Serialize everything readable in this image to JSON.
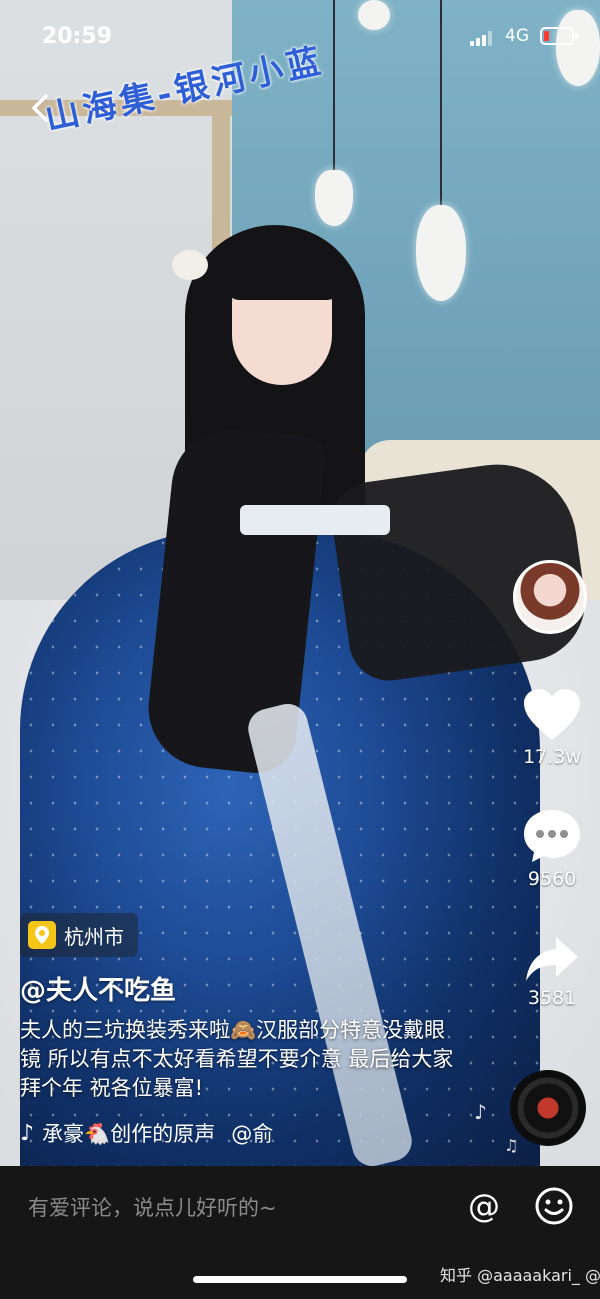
{
  "status_bar": {
    "time": "20:59",
    "network": "4G",
    "battery_level": 0.1,
    "battery_color": "#ff3b30"
  },
  "nav": {
    "back_icon": "chevron-left-icon"
  },
  "overlay_title": "山海集-银河小蓝",
  "right_rail": {
    "avatar": "author-avatar",
    "like": {
      "icon": "heart-icon",
      "count": "17.3w"
    },
    "comment": {
      "icon": "comment-bubble-icon",
      "count": "9560"
    },
    "share": {
      "icon": "share-arrow-icon",
      "count": "3581"
    }
  },
  "post": {
    "location": "杭州市",
    "author": "@夫人不吃鱼",
    "description": "夫人的三坑换装秀来啦🙈汉服部分特意没戴眼镜 所以有点不太好看希望不要介意 最后给大家拜个年 祝各位暴富!",
    "music_prefix": "承豪🐔创作的原声",
    "music_suffix": "@俞"
  },
  "comment_bar": {
    "placeholder": "有爱评论，说点儿好听的~",
    "at_symbol": "@"
  },
  "credit": "知乎 @aaaaakari_ @丁小晨同学",
  "colors": {
    "accent": "#2e5fd6",
    "bar": "#161616"
  }
}
